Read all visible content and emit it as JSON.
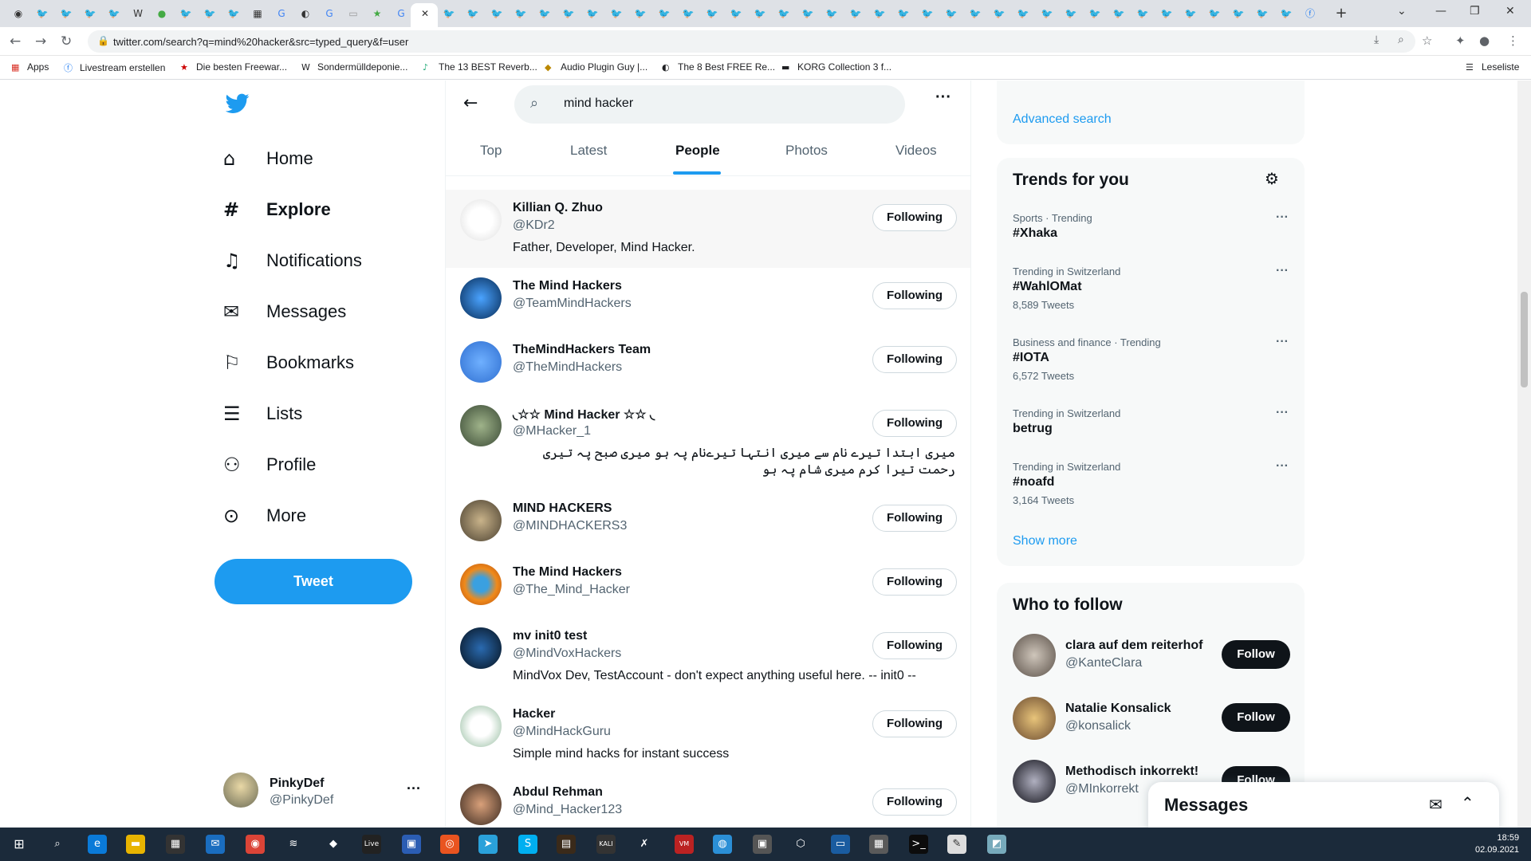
{
  "browser": {
    "url": "twitter.com/search?q=mind%20hacker&src=typed_query&f=user",
    "bookmarks": [
      {
        "label": "Apps",
        "icon": "apps-grid-icon"
      },
      {
        "label": "Livestream erstellen",
        "icon": "facebook-icon"
      },
      {
        "label": "Die besten Freewar...",
        "icon": "star-icon"
      },
      {
        "label": "Sondermülldeponie...",
        "icon": "wikipedia-icon"
      },
      {
        "label": "The 13 BEST Reverb...",
        "icon": "music-icon"
      },
      {
        "label": "Audio Plugin Guy |...",
        "icon": "plugin-icon"
      },
      {
        "label": "The 8 Best FREE Re...",
        "icon": "moon-icon"
      },
      {
        "label": "KORG Collection 3 f...",
        "icon": "korg-icon"
      }
    ],
    "reading_list": "Leseliste"
  },
  "nav": {
    "items": [
      {
        "label": "Home",
        "icon": "⌂"
      },
      {
        "label": "Explore",
        "icon": "#"
      },
      {
        "label": "Notifications",
        "icon": "🔔"
      },
      {
        "label": "Messages",
        "icon": "✉"
      },
      {
        "label": "Bookmarks",
        "icon": "🔖"
      },
      {
        "label": "Lists",
        "icon": "☰"
      },
      {
        "label": "Profile",
        "icon": "👤"
      },
      {
        "label": "More",
        "icon": "⋯"
      }
    ],
    "tweet_label": "Tweet",
    "account": {
      "name": "PinkyDef",
      "handle": "@PinkyDef"
    }
  },
  "search": {
    "query": "mind hacker",
    "tabs": [
      "Top",
      "Latest",
      "People",
      "Photos",
      "Videos"
    ],
    "active_tab": "People"
  },
  "users": [
    {
      "name": "Killian Q. Zhuo",
      "handle": "@KDr2",
      "bio": "Father, Developer, Mind Hacker.",
      "button": "Following"
    },
    {
      "name": "The Mind Hackers",
      "handle": "@TeamMindHackers",
      "bio": "",
      "button": "Following"
    },
    {
      "name": "TheMindHackers Team",
      "handle": "@TheMindHackers",
      "bio": "",
      "button": "Following"
    },
    {
      "name": "◟☆☆ Mind Hacker ☆☆ ◟",
      "handle": "@MHacker_1",
      "bio": "میری ابتدا تیرے نام سے میری انتہا تیرےنام پہ ہو میری صبح پہ تیری رحمت تیرا کرم میری شام پہ ہو",
      "button": "Following"
    },
    {
      "name": "MIND HACKERS",
      "handle": "@MINDHACKERS3",
      "bio": "",
      "button": "Following"
    },
    {
      "name": "The Mind Hackers",
      "handle": "@The_Mind_Hacker",
      "bio": "",
      "button": "Following"
    },
    {
      "name": "mv init0 test",
      "handle": "@MindVoxHackers",
      "bio": "MindVox Dev, TestAccount - don't expect anything useful here. -- init0 --",
      "button": "Following"
    },
    {
      "name": "Hacker",
      "handle": "@MindHackGuru",
      "bio": "Simple mind hacks for instant success",
      "button": "Following"
    },
    {
      "name": "Abdul Rehman",
      "handle": "@Mind_Hacker123",
      "bio": "",
      "button": "Following"
    }
  ],
  "sidebar": {
    "advanced_search": "Advanced search",
    "trends_title": "Trends for you",
    "trends": [
      {
        "context": "Sports · Trending",
        "name": "#Xhaka",
        "count": ""
      },
      {
        "context": "Trending in Switzerland",
        "name": "#WahlOMat",
        "count": "8,589 Tweets"
      },
      {
        "context": "Business and finance · Trending",
        "name": "#IOTA",
        "count": "6,572 Tweets"
      },
      {
        "context": "Trending in Switzerland",
        "name": "betrug",
        "count": ""
      },
      {
        "context": "Trending in Switzerland",
        "name": "#noafd",
        "count": "3,164 Tweets"
      }
    ],
    "show_more": "Show more",
    "who_to_follow_title": "Who to follow",
    "who_to_follow": [
      {
        "name": "clara auf dem reiterhof",
        "handle": "@KanteClara",
        "button": "Follow"
      },
      {
        "name": "Natalie Konsalick",
        "handle": "@konsalick",
        "button": "Follow"
      },
      {
        "name": "Methodisch inkorrekt!",
        "handle": "@MInkorrekt",
        "button": "Follow"
      }
    ],
    "messages_drawer": "Messages"
  },
  "taskbar": {
    "time": "18:59",
    "date": "02.09.2021"
  },
  "colors": {
    "accent": "#1d9bf0",
    "text": "#0f1419",
    "muted": "#536471",
    "taskbar": "#1b2a3a"
  }
}
